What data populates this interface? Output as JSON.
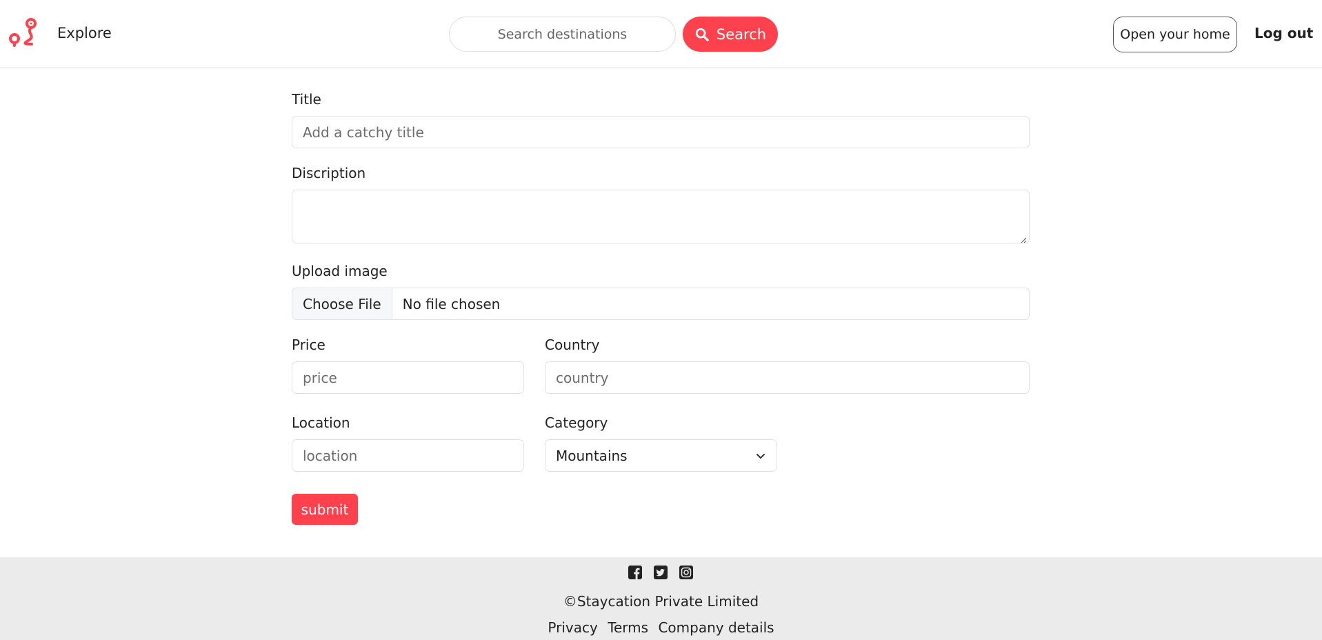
{
  "navbar": {
    "explore_label": "Explore",
    "search_placeholder": "Search destinations",
    "search_button_label": "Search",
    "open_home_label": "Open your home",
    "logout_label": "Log out",
    "brand_color": "#fe424d"
  },
  "form": {
    "title_label": "Title",
    "title_placeholder": "Add a catchy title",
    "description_label": "Discription",
    "description_value": "",
    "upload_label": "Upload image",
    "file_button_label": "Choose File",
    "file_status": "No file chosen",
    "price_label": "Price",
    "price_placeholder": "price",
    "country_label": "Country",
    "country_placeholder": "country",
    "location_label": "Location",
    "location_placeholder": "location",
    "category_label": "Category",
    "category_selected": "Mountains",
    "submit_label": "submit"
  },
  "footer": {
    "social_icons": [
      "facebook-icon",
      "twitter-icon",
      "instagram-icon"
    ],
    "copyright": "©Staycation Private Limited",
    "links": [
      "Privacy",
      "Terms",
      "Company details"
    ]
  }
}
